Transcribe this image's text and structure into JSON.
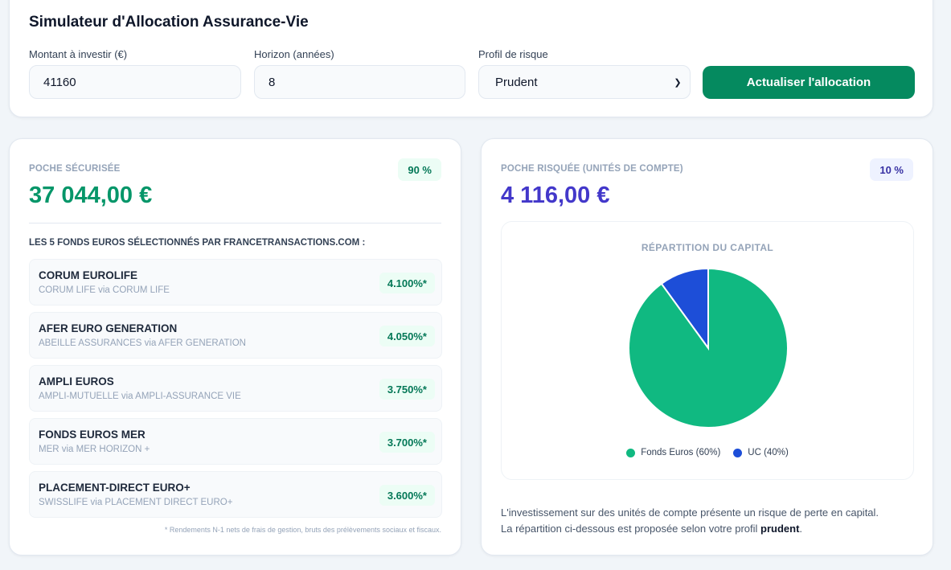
{
  "header": {
    "title": "Simulateur d'Allocation Assurance-Vie",
    "amount_label": "Montant à investir (€)",
    "amount_value": "41160",
    "horizon_label": "Horizon (années)",
    "horizon_value": "8",
    "profile_label": "Profil de risque",
    "profile_value": "Prudent",
    "submit_label": "Actualiser l'allocation"
  },
  "secured": {
    "label": "POCHE SÉCURISÉE",
    "percent": "90 %",
    "amount": "37 044,00 €",
    "funds_heading": "LES 5 FONDS EUROS SÉLECTIONNÉS PAR FRANCETRANSACTIONS.COM :",
    "funds": [
      {
        "name": "CORUM EUROLIFE",
        "provider": "CORUM LIFE via CORUM LIFE",
        "rate": "4.100%*"
      },
      {
        "name": "AFER EURO GENERATION",
        "provider": "ABEILLE ASSURANCES via AFER GENERATION",
        "rate": "4.050%*"
      },
      {
        "name": "AMPLI EUROS",
        "provider": "AMPLI-MUTUELLE via AMPLI-ASSURANCE VIE",
        "rate": "3.750%*"
      },
      {
        "name": "FONDS EUROS MER",
        "provider": "MER via MER HORIZON +",
        "rate": "3.700%*"
      },
      {
        "name": "PLACEMENT-DIRECT EURO+",
        "provider": "SWISSLIFE via PLACEMENT DIRECT EURO+",
        "rate": "3.600%*"
      }
    ],
    "footnote": "* Rendements N-1 nets de frais de gestion, bruts des prélèvements sociaux et fiscaux."
  },
  "risky": {
    "label": "POCHE RISQUÉE (UNITÉS DE COMPTE)",
    "percent": "10 %",
    "amount": "4 116,00 €",
    "disclaimer_line1": "L'investissement sur des unités de compte présente un risque de perte en capital.",
    "disclaimer_line2_prefix": "La répartition ci-dessous est proposée selon votre profil ",
    "disclaimer_profile": "prudent",
    "disclaimer_line2_suffix": "."
  },
  "colors": {
    "primary_green": "#058a5f",
    "secured_green": "#059669",
    "risky_indigo": "#4338ca",
    "pie_euros": "#10b981",
    "pie_uc": "#1d4ed8"
  },
  "chart_data": {
    "type": "pie",
    "title": "RÉPARTITION DU CAPITAL",
    "categories": [
      "Fonds Euros (60%)",
      "UC (40%)"
    ],
    "values": [
      90,
      10
    ],
    "colors": [
      "#10b981",
      "#1d4ed8"
    ],
    "legend": "bottom"
  }
}
